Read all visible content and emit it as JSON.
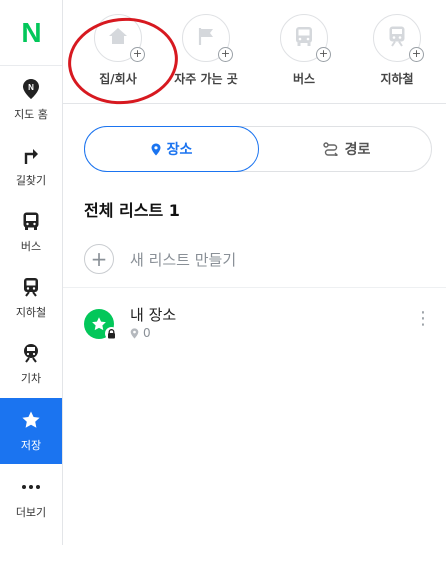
{
  "logo": "N",
  "rail": {
    "items": [
      {
        "id": "map-home",
        "label": "지도 홈",
        "icon": "map-pin-icon"
      },
      {
        "id": "directions",
        "label": "길찾기",
        "icon": "turn-arrow-icon"
      },
      {
        "id": "bus",
        "label": "버스",
        "icon": "bus-icon"
      },
      {
        "id": "subway",
        "label": "지하철",
        "icon": "subway-icon"
      },
      {
        "id": "train",
        "label": "기차",
        "icon": "train-icon"
      },
      {
        "id": "saved",
        "label": "저장",
        "icon": "star-icon",
        "active": true
      },
      {
        "id": "more",
        "label": "더보기",
        "icon": "more-icon"
      }
    ]
  },
  "categories": [
    {
      "label": "집/회사",
      "icon": "home-icon"
    },
    {
      "label": "자주 가는 곳",
      "icon": "flag-icon"
    },
    {
      "label": "버스",
      "icon": "bus-icon"
    },
    {
      "label": "지하철",
      "icon": "subway-icon"
    }
  ],
  "tabs": {
    "place": "장소",
    "route": "경로"
  },
  "list_title": "전체 리스트 1",
  "new_list_label": "새 리스트 만들기",
  "saved_list": {
    "name": "내 장소",
    "count": "0"
  },
  "colors": {
    "brand_green": "#03c75a",
    "accent_blue": "#1b74f0",
    "annotation_red": "#d71920"
  }
}
